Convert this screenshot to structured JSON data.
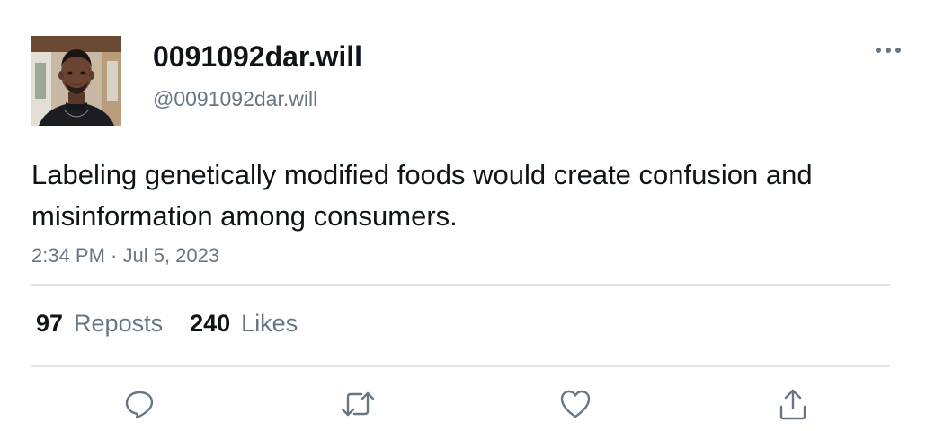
{
  "user": {
    "display_name": "0091092dar.will",
    "handle": "@0091092dar.will"
  },
  "tweet": {
    "text": "Labeling genetically modified foods would create confusion and misinformation among consumers.",
    "timestamp": "2:34 PM · Jul 5, 2023"
  },
  "stats": {
    "reposts_count": "97",
    "reposts_label": "Reposts",
    "likes_count": "240",
    "likes_label": "Likes"
  },
  "icons": {
    "more": "more-horizontal-icon",
    "reply": "reply-icon",
    "retweet": "retweet-icon",
    "like": "heart-icon",
    "share": "share-icon"
  },
  "colors": {
    "text_primary": "#0f1419",
    "text_secondary": "#687684",
    "divider": "#e1e4e8"
  }
}
